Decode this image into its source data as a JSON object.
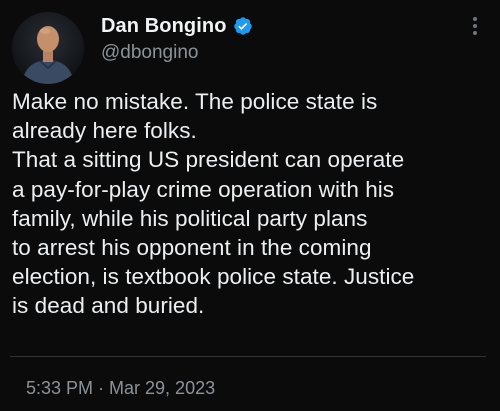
{
  "author": {
    "display_name": "Dan Bongino",
    "handle": "@dbongino",
    "verified": true,
    "verified_color": "#1d9bf0"
  },
  "tweet": {
    "lines": [
      "Make no mistake. The police state is",
      "already here folks.",
      "That a sitting US president can operate",
      "a pay-for-play crime operation with his",
      "family, while his political party plans",
      "to arrest his opponent in the coming",
      "election, is textbook police state. Justice",
      "is dead and buried."
    ],
    "timestamp": "5:33 PM · Mar 29, 2023"
  },
  "icons": {
    "avatar": "avatar",
    "verified": "verified-badge-icon",
    "more": "more-options-icon"
  },
  "colors": {
    "background": "#0b0b0b",
    "text": "#eceff1",
    "secondary_text": "#8b9298"
  }
}
